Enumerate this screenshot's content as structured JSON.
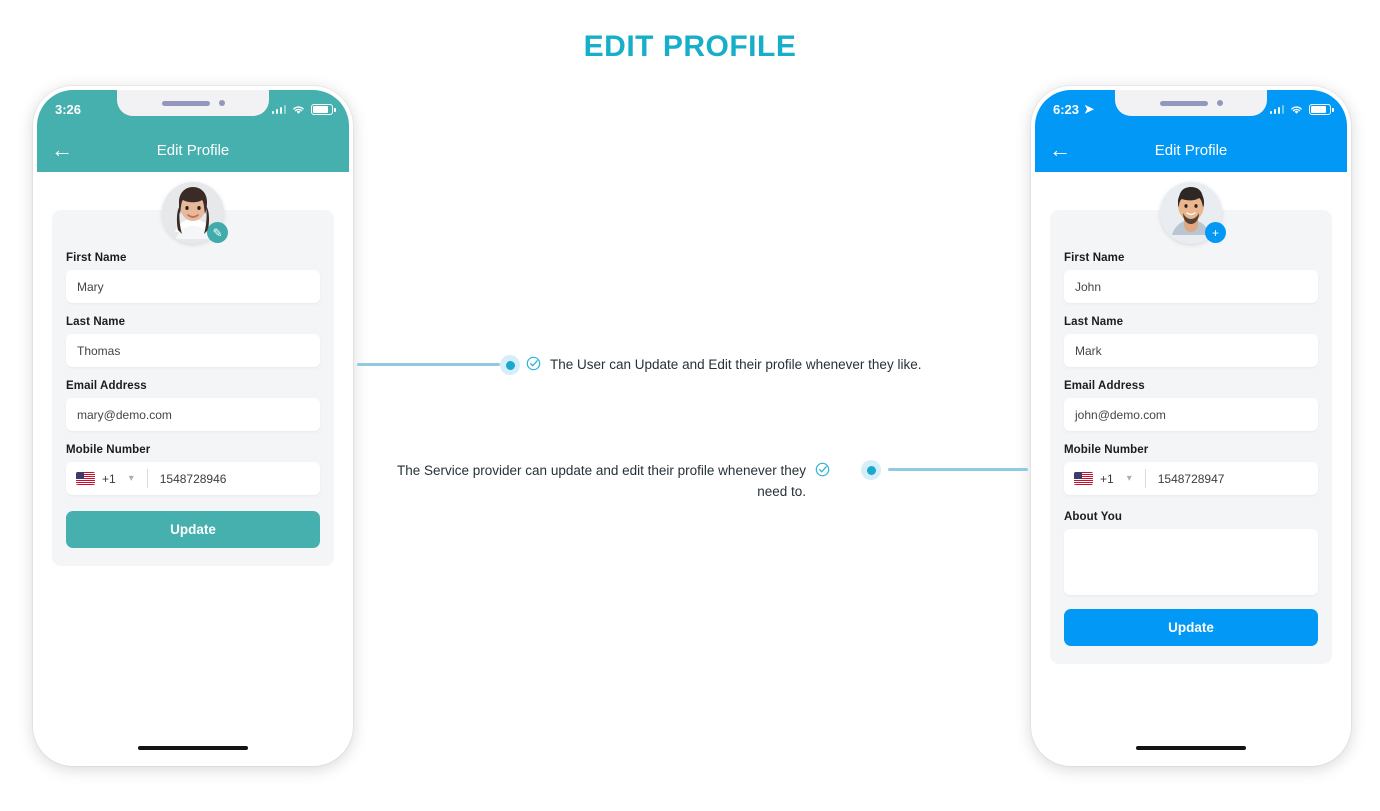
{
  "page": {
    "title": "EDIT PROFILE",
    "accent": "#17AECA"
  },
  "phones": [
    {
      "id": "user-phone",
      "theme": {
        "name": "teal",
        "header": "#45B0AE",
        "button": "#45B0AE",
        "badge": "#3FABAB"
      },
      "status_bar": {
        "time": "3:26",
        "location_arrow": false,
        "signal_icon": "signal-icon",
        "wifi_icon": "wifi-icon",
        "battery_icon": "battery-icon"
      },
      "appbar": {
        "back_icon": "back-arrow-icon",
        "title": "Edit Profile"
      },
      "avatar": {
        "name": "user-avatar",
        "badge_icon": "pencil-icon",
        "badge_glyph": "✎"
      },
      "fields": [
        {
          "label": "First Name",
          "value": "Mary",
          "name": "first-name"
        },
        {
          "label": "Last Name",
          "value": "Thomas",
          "name": "last-name"
        },
        {
          "label": "Email Address",
          "value": "mary@demo.com",
          "name": "email-address"
        }
      ],
      "mobile": {
        "label": "Mobile Number",
        "flag": "us-flag-icon",
        "country_code": "+1",
        "chevron": "chevron-down-icon",
        "number": "1548728946"
      },
      "about": null,
      "update_label": "Update"
    },
    {
      "id": "provider-phone",
      "theme": {
        "name": "blue",
        "header": "#0199F5",
        "button": "#0199F5",
        "badge": "#0199F5"
      },
      "status_bar": {
        "time": "6:23",
        "location_arrow": true,
        "signal_icon": "signal-icon",
        "wifi_icon": "wifi-icon",
        "battery_icon": "battery-icon"
      },
      "appbar": {
        "back_icon": "back-arrow-icon",
        "title": "Edit Profile"
      },
      "avatar": {
        "name": "provider-avatar",
        "badge_icon": "plus-icon",
        "badge_glyph": "+"
      },
      "fields": [
        {
          "label": "First Name",
          "value": "John",
          "name": "first-name"
        },
        {
          "label": "Last Name",
          "value": "Mark",
          "name": "last-name"
        },
        {
          "label": "Email Address",
          "value": "john@demo.com",
          "name": "email-address"
        }
      ],
      "mobile": {
        "label": "Mobile Number",
        "flag": "us-flag-icon",
        "country_code": "+1",
        "chevron": "chevron-down-icon",
        "number": "1548728947"
      },
      "about": {
        "label": "About You",
        "value": ""
      },
      "update_label": "Update"
    }
  ],
  "annotations": [
    {
      "id": "annotation-user",
      "text": "The User can Update and Edit their profile whenever they like.",
      "check_icon": "check-circle-icon",
      "dot": "connector-dot",
      "line": "connector-line",
      "align": "left"
    },
    {
      "id": "annotation-provider",
      "text": "The Service provider can update and edit their profile whenever they need to.",
      "check_icon": "check-circle-icon",
      "dot": "connector-dot",
      "line": "connector-line",
      "align": "right"
    }
  ],
  "colors": {
    "connector": "#8ECBE2",
    "dot_center": "#1AA7D0",
    "dot_halo": "#D6EEF7",
    "check": "#2BB3D6",
    "card_bg": "#F4F5F6"
  }
}
